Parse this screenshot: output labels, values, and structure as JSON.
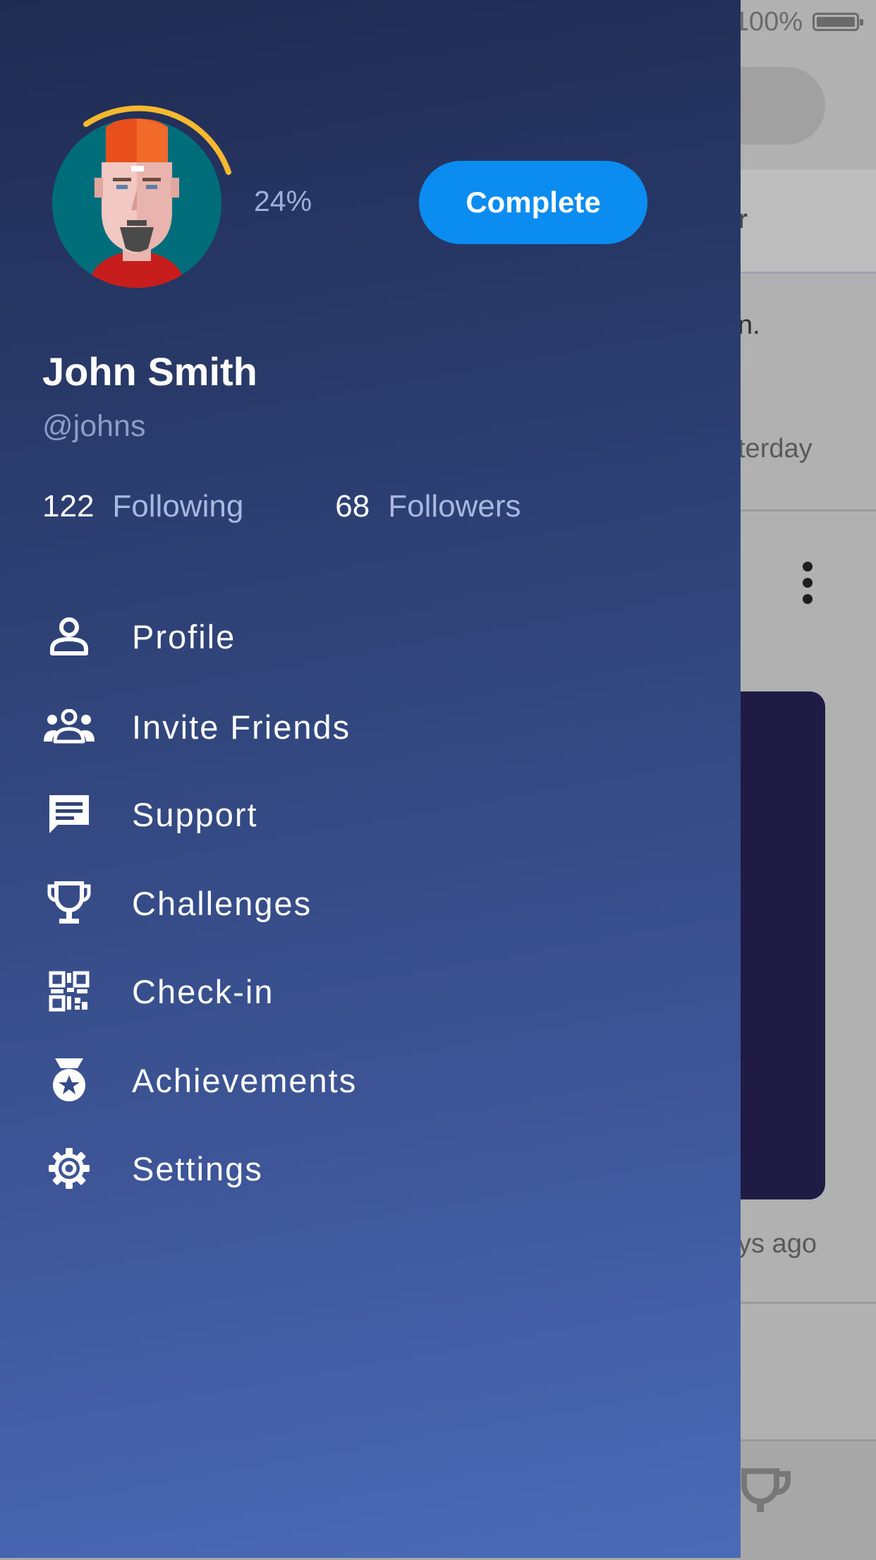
{
  "background_app": {
    "battery_text": "100%",
    "tab_fragment": "er",
    "line1_fragment": "n.",
    "line2_fragment": "terday",
    "line3_fragment": "ys ago"
  },
  "drawer": {
    "profile_progress": "24%",
    "progress_fraction": 0.24,
    "complete_button": "Complete",
    "user_name": "John Smith",
    "user_handle": "@johns",
    "following_count": "122",
    "following_label": "Following",
    "followers_count": "68",
    "followers_label": "Followers",
    "menu": [
      {
        "label": "Profile",
        "icon": "person-icon"
      },
      {
        "label": "Invite Friends",
        "icon": "group-icon"
      },
      {
        "label": "Support",
        "icon": "chat-icon"
      },
      {
        "label": "Challenges",
        "icon": "trophy-icon"
      },
      {
        "label": "Check-in",
        "icon": "qr-code-icon"
      },
      {
        "label": "Achievements",
        "icon": "medal-icon"
      },
      {
        "label": "Settings",
        "icon": "gear-icon"
      }
    ]
  },
  "colors": {
    "drawer_top": "#1f2b52",
    "drawer_bottom": "#4a6ab8",
    "accent_button": "#0a8cf0",
    "progress_arc": "#f5b82e",
    "avatar_bg": "#006e7a"
  }
}
